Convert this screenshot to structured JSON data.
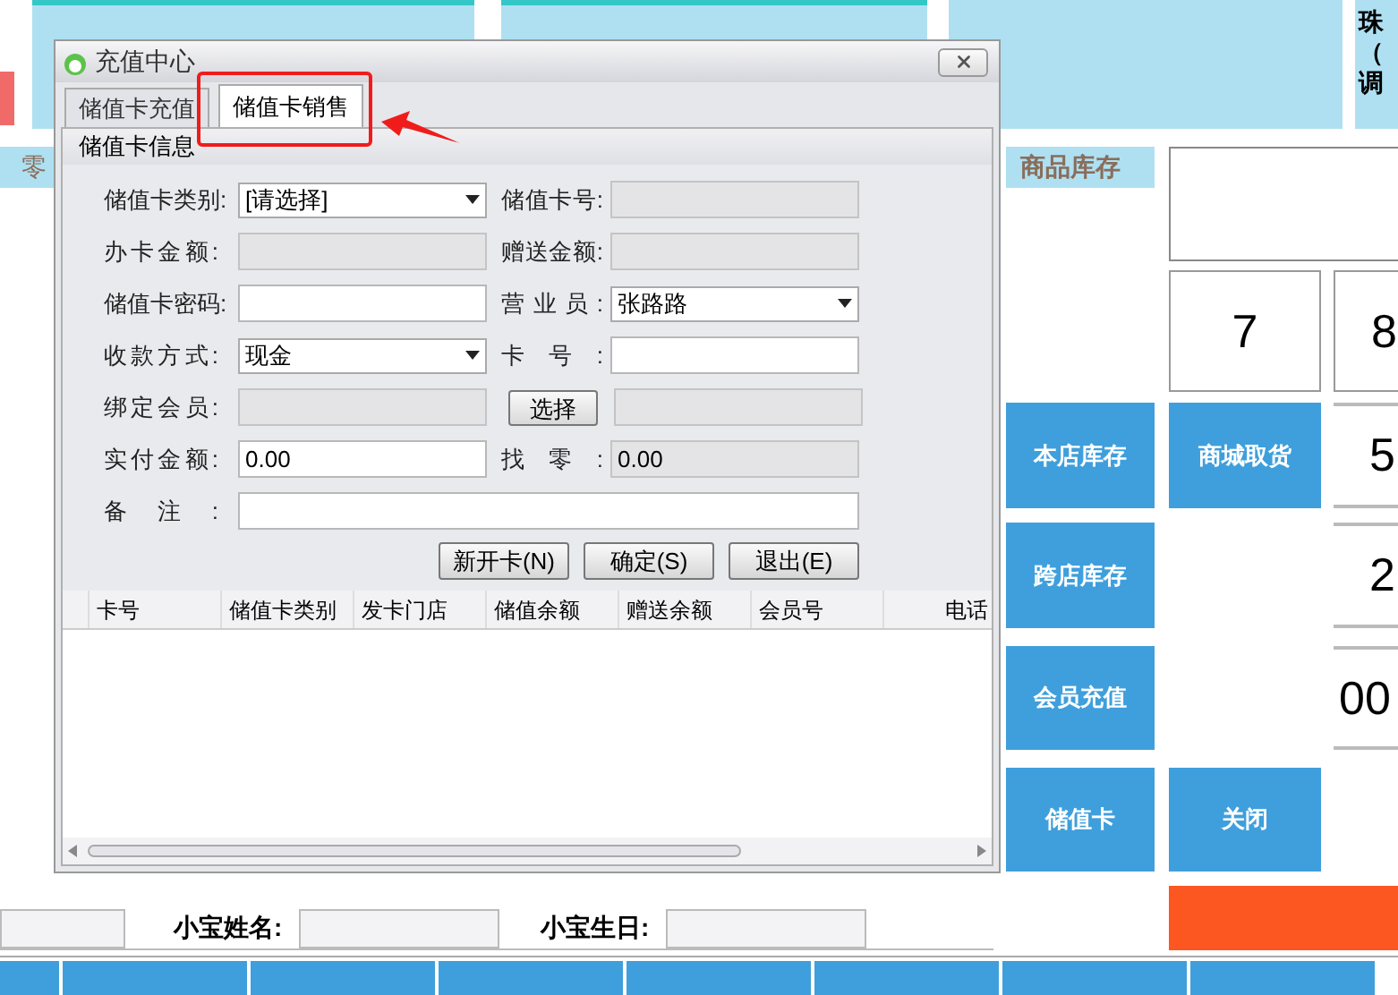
{
  "background": {
    "corner_lines": [
      "珠",
      "（",
      "调"
    ],
    "side_tab": "零",
    "stock_label": "商品库存",
    "keypad": [
      "7",
      "8",
      "5",
      "2",
      "00"
    ],
    "action_buttons": [
      "本店库存",
      "商城取货",
      "跨店库存",
      "会员充值",
      "储值卡",
      "关闭"
    ],
    "member_fields": [
      {
        "label": "小宝姓名:"
      },
      {
        "label": "小宝生日:"
      }
    ]
  },
  "dialog": {
    "title": "充值中心",
    "tabs": [
      {
        "label": "储值卡充值",
        "selected": false
      },
      {
        "label": "储值卡销售",
        "selected": true
      }
    ],
    "group_title": "储值卡信息",
    "rows": [
      {
        "left": {
          "label": "储值卡类别:",
          "kind": "select",
          "value": "[请选择]"
        },
        "right": {
          "label": "储值卡号:",
          "kind": "input",
          "disabled": true
        }
      },
      {
        "left": {
          "label": "办卡金额:",
          "kind": "input",
          "disabled": true
        },
        "right": {
          "label": "赠送金额:",
          "kind": "input",
          "disabled": true
        }
      },
      {
        "left": {
          "label": "储值卡密码:",
          "kind": "input",
          "disabled": false
        },
        "right": {
          "label": "营业员:",
          "kind": "select",
          "value": "张路路"
        }
      },
      {
        "left": {
          "label": "收款方式:",
          "kind": "select",
          "value": "现金"
        },
        "right": {
          "label": "卡号:",
          "kind": "input",
          "disabled": false
        }
      },
      {
        "left": {
          "label": "绑定会员:",
          "kind": "input",
          "disabled": true
        },
        "right": {
          "button": "选择",
          "kind": "input",
          "disabled": true
        }
      },
      {
        "left": {
          "label": "实付金额:",
          "kind": "input",
          "value": "0.00",
          "disabled": false
        },
        "right": {
          "label": "找零:",
          "kind": "input",
          "value": "0.00",
          "disabled": true
        }
      },
      {
        "left": {
          "label": "备注:",
          "kind": "input",
          "disabled": false,
          "wide": true
        }
      }
    ],
    "buttons": [
      "新开卡(N)",
      "确定(S)",
      "退出(E)"
    ],
    "table": {
      "columns": [
        "卡号",
        "储值卡类别",
        "发卡门店",
        "储值余额",
        "赠送余额",
        "会员号",
        "电话"
      ]
    }
  }
}
